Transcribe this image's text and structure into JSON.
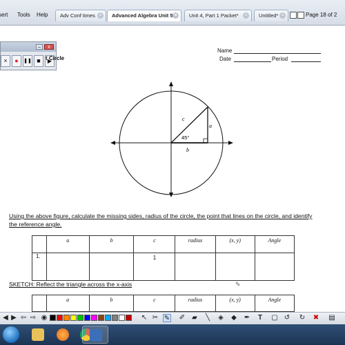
{
  "app": {
    "menu": [
      "sert",
      "Tools",
      "Help"
    ],
    "tabs": [
      {
        "label": "Adv Conf times",
        "active": false
      },
      {
        "label": "Advanced Algebra Unit 5*",
        "active": true
      },
      {
        "label": "Unit 4, Part 1 Packet*",
        "active": false
      },
      {
        "label": "Untitled*",
        "active": false
      }
    ],
    "page_indicator": "Page 18 of 2"
  },
  "recorder": {
    "close_symbol": "x",
    "minimize_symbol": "–",
    "buttons": [
      {
        "name": "cancel",
        "symbol": "×"
      },
      {
        "name": "record",
        "symbol": "●"
      },
      {
        "name": "pause",
        "symbol": "❚❚"
      },
      {
        "name": "stop",
        "symbol": "■"
      },
      {
        "name": "play",
        "symbol": "▶"
      }
    ]
  },
  "worksheet": {
    "title_fragment": "t Circle",
    "name_label": "Name",
    "date_label": "Date",
    "period_label": "Period",
    "figure": {
      "label_c": "c",
      "label_a": "a",
      "label_b": "b",
      "angle": "45°"
    },
    "instructions": "Using the above figure, calculate the missing sides, radius of the circle, the point that lines on the circle, and identify the reference angle.",
    "table1": {
      "headers": [
        "",
        "a",
        "b",
        "c",
        "radius",
        "(x, y)",
        "Angle"
      ],
      "row": [
        "1.",
        "",
        "",
        "1",
        "",
        "",
        ""
      ]
    },
    "sketch_title": "SKETCH: Reflect the triangle across the x-axis",
    "table2": {
      "headers": [
        "",
        "a",
        "b",
        "c",
        "radius",
        "(x, y)",
        "Angle"
      ]
    }
  },
  "colors": {
    "taskbar": "#1c3453",
    "record_red": "#e02020",
    "pen_highlight": "#2a6fd6",
    "swatches": [
      "#000000",
      "#ff0000",
      "#ff8800",
      "#ffff00",
      "#00c000",
      "#0000ff",
      "#ff00ff",
      "#8b4513",
      "#00aaff",
      "#808080",
      "#ffffff",
      "#c00000"
    ]
  },
  "draw_tools": [
    "cursor-icon",
    "tools-icon",
    "pen-icon",
    "highlighter-icon",
    "eraser-icon",
    "fill-icon",
    "line-icon",
    "text-icon",
    "screen-icon",
    "undo-icon",
    "redo-icon",
    "delete-icon"
  ],
  "taskbar_apps": [
    "explorer-icon",
    "media-player-icon",
    "chrome-icon",
    "smart-notebook-icon"
  ]
}
